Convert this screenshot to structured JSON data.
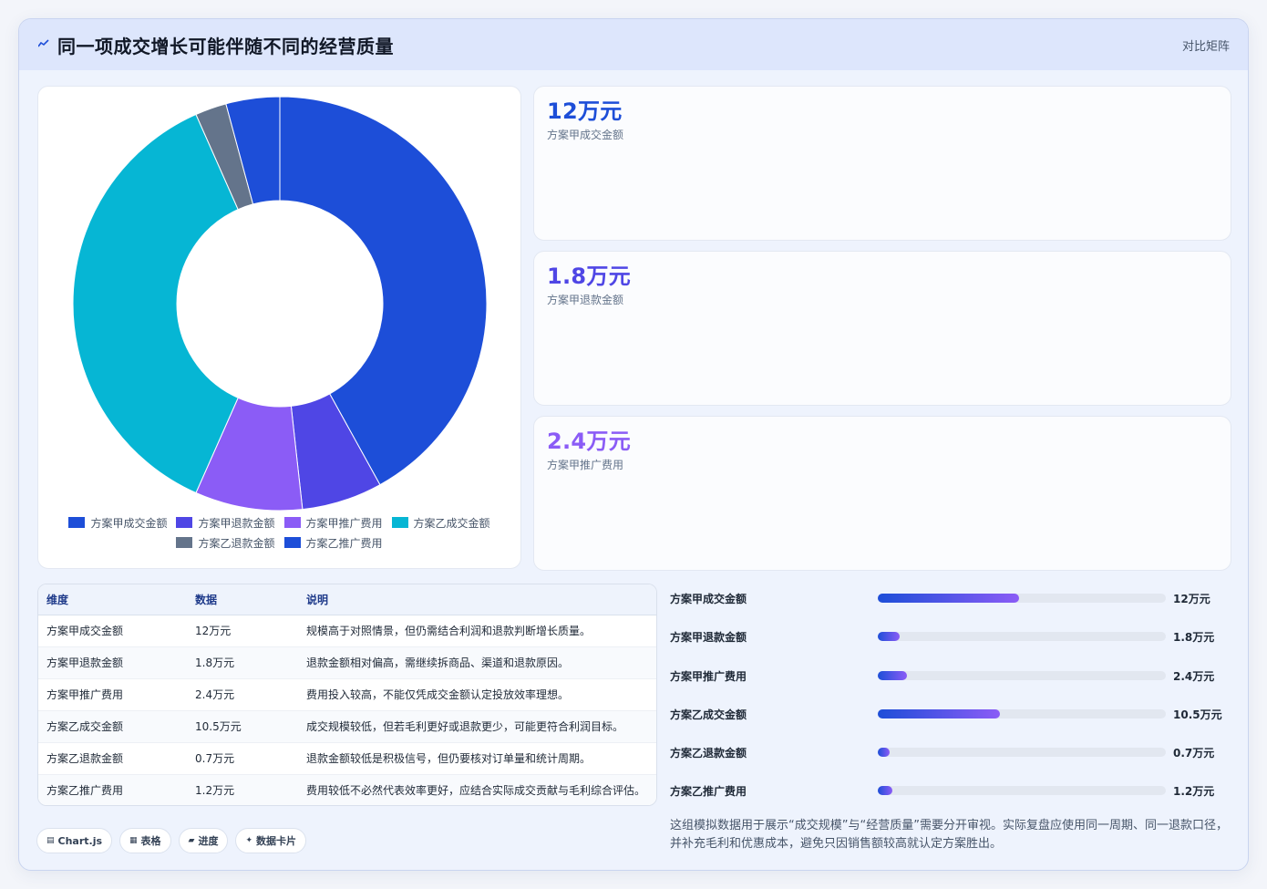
{
  "header": {
    "title": "同一项成交增长可能伴随不同的经营质量",
    "link": "对比矩阵",
    "icon": "sparkline-icon"
  },
  "chart_data": {
    "type": "pie",
    "categories": [
      "方案甲成交金额",
      "方案甲退款金额",
      "方案甲推广费用",
      "方案乙成交金额",
      "方案乙退款金额",
      "方案乙推广费用"
    ],
    "values": [
      12,
      1.8,
      2.4,
      10.5,
      0.7,
      1.2
    ],
    "colors": [
      "#1d4ed8",
      "#4f46e5",
      "#8b5cf6",
      "#06b6d4",
      "#64748b",
      "#1d4ed8"
    ],
    "donut": true,
    "legend_position": "bottom"
  },
  "kpis": [
    {
      "value": "12万元",
      "label": "方案甲成交金额",
      "color": "#1d4ed8"
    },
    {
      "value": "1.8万元",
      "label": "方案甲退款金额",
      "color": "#4f46e5"
    },
    {
      "value": "2.4万元",
      "label": "方案甲推广费用",
      "color": "#8b5cf6"
    }
  ],
  "table": {
    "headers": [
      "维度",
      "数据",
      "说明"
    ],
    "rows": [
      [
        "方案甲成交金额",
        "12万元",
        "规模高于对照情景，但仍需结合利润和退款判断增长质量。"
      ],
      [
        "方案甲退款金额",
        "1.8万元",
        "退款金额相对偏高，需继续拆商品、渠道和退款原因。"
      ],
      [
        "方案甲推广费用",
        "2.4万元",
        "费用投入较高，不能仅凭成交金额认定投放效率理想。"
      ],
      [
        "方案乙成交金额",
        "10.5万元",
        "成交规模较低，但若毛利更好或退款更少，可能更符合利润目标。"
      ],
      [
        "方案乙退款金额",
        "0.7万元",
        "退款金额较低是积极信号，但仍要核对订单量和统计周期。"
      ],
      [
        "方案乙推广费用",
        "1.2万元",
        "费用较低不必然代表效率更好，应结合实际成交贡献与毛利综合评估。"
      ]
    ]
  },
  "bars": [
    {
      "label": "方案甲成交金额",
      "value_text": "12万元",
      "fraction": 0.49
    },
    {
      "label": "方案甲退款金额",
      "value_text": "1.8万元",
      "fraction": 0.075
    },
    {
      "label": "方案甲推广费用",
      "value_text": "2.4万元",
      "fraction": 0.1
    },
    {
      "label": "方案乙成交金额",
      "value_text": "10.5万元",
      "fraction": 0.425
    },
    {
      "label": "方案乙退款金额",
      "value_text": "0.7万元",
      "fraction": 0.04
    },
    {
      "label": "方案乙推广费用",
      "value_text": "1.2万元",
      "fraction": 0.05
    }
  ],
  "note": "这组模拟数据用于展示“成交规模”与“经营质量”需要分开审视。实际复盘应使用同一周期、同一退款口径，并补充毛利和优惠成本，避免只因销售额较高就认定方案胜出。",
  "tags": [
    {
      "icon": "chart-icon",
      "label": "Chart.js"
    },
    {
      "icon": "table-icon",
      "label": "表格"
    },
    {
      "icon": "progress-icon",
      "label": "进度"
    },
    {
      "icon": "sparkle-icon",
      "label": "数据卡片"
    }
  ]
}
